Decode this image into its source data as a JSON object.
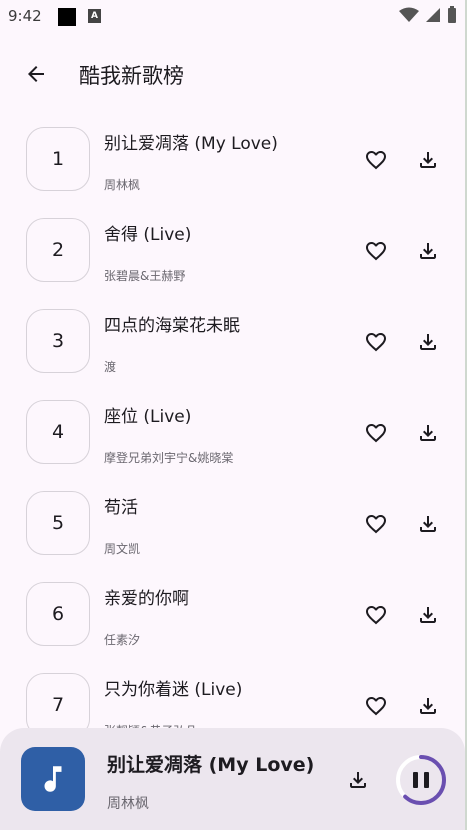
{
  "status": {
    "time": "9:42",
    "a_badge": "A"
  },
  "header": {
    "title": "酷我新歌榜"
  },
  "songs": [
    {
      "rank": "1",
      "title": "别让爱凋落 (My Love)",
      "artist": "周林枫"
    },
    {
      "rank": "2",
      "title": "舍得 (Live)",
      "artist": "张碧晨&王赫野"
    },
    {
      "rank": "3",
      "title": "四点的海棠花未眠",
      "artist": "渡"
    },
    {
      "rank": "4",
      "title": "座位 (Live)",
      "artist": "摩登兄弟刘宇宁&姚晓棠"
    },
    {
      "rank": "5",
      "title": "苟活",
      "artist": "周文凯"
    },
    {
      "rank": "6",
      "title": "亲爱的你啊",
      "artist": "任素汐"
    },
    {
      "rank": "7",
      "title": "只为你着迷 (Live)",
      "artist": "张靓颖&黄子弘凡"
    }
  ],
  "player": {
    "title": "别让爱凋落 (My Love)",
    "artist": "周林枫",
    "progress": 0.62,
    "accent": "#6a4fb0",
    "art_color": "#2f5fa6"
  },
  "icons": {
    "back": "arrow-left-icon",
    "favorite": "heart-outline-icon",
    "download": "download-icon",
    "note": "music-note-icon",
    "pause": "pause-icon"
  }
}
